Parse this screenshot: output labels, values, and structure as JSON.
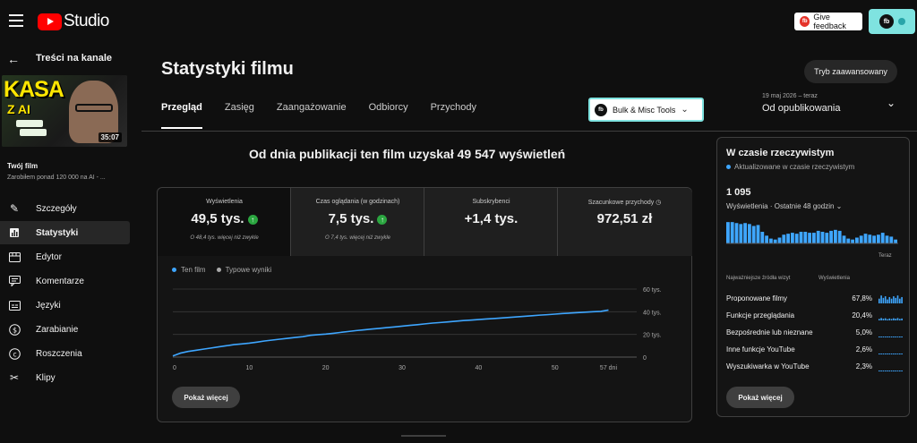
{
  "app": {
    "studio_label": "Studio",
    "feedback_label": "Give feedback",
    "feedback_icon": "fb",
    "account_icon": "fb"
  },
  "sidebar": {
    "back_title": "Treści na kanale",
    "thumbnail": {
      "text_main": "KASA",
      "text_sub": "Z AI",
      "duration": "35:07"
    },
    "film_label": "Twój film",
    "film_title": "Zarobiłem ponad 120 000 na AI - ...",
    "items": [
      {
        "label": "Szczegóły",
        "icon": "pencil-icon",
        "active": false
      },
      {
        "label": "Statystyki",
        "icon": "analytics-icon",
        "active": true
      },
      {
        "label": "Edytor",
        "icon": "editor-icon",
        "active": false
      },
      {
        "label": "Komentarze",
        "icon": "comments-icon",
        "active": false
      },
      {
        "label": "Języki",
        "icon": "subtitles-icon",
        "active": false
      },
      {
        "label": "Zarabianie",
        "icon": "dollar-icon",
        "active": false
      },
      {
        "label": "Roszczenia",
        "icon": "copyright-icon",
        "active": false
      },
      {
        "label": "Klipy",
        "icon": "scissors-icon",
        "active": false
      }
    ]
  },
  "main": {
    "title": "Statystyki filmu",
    "advanced_button": "Tryb zaawansowany",
    "tabs": [
      "Przegląd",
      "Zasięg",
      "Zaangażowanie",
      "Odbiorcy",
      "Przychody"
    ],
    "bulk_tools": {
      "label": "Bulk & Misc Tools",
      "icon": "fb"
    },
    "date_range": "19 maj 2026 – teraz",
    "date_label": "Od opublikowania",
    "headline": "Od dnia publikacji ten film uzyskał 49 547 wyświetleń",
    "metrics": [
      {
        "label": "Wyświetlenia",
        "value": "49,5 tys.",
        "up": "↑",
        "sub": "O 48,4 tys. więcej niż zwykle"
      },
      {
        "label": "Czas oglądania (w godzinach)",
        "value": "7,5 tys.",
        "up": "↑",
        "sub": "O 7,4 tys. więcej niż zwykle"
      },
      {
        "label": "Subskrybenci",
        "value": "+1,4 tys.",
        "up": "",
        "sub": ""
      },
      {
        "label": "Szacunkowe przychody",
        "value": "972,51 zł",
        "up": "",
        "sub": ""
      }
    ],
    "legend": {
      "this_film": "Ten film",
      "typical": "Typowe wyniki"
    },
    "show_more": "Pokaż więcej"
  },
  "chart_data": {
    "type": "line",
    "series": [
      {
        "name": "Ten film",
        "x": [
          0,
          1,
          2,
          3,
          4,
          5,
          6,
          7,
          8,
          9,
          10,
          11,
          12,
          13,
          14,
          15,
          16,
          17,
          18,
          19,
          20,
          21,
          22,
          23,
          24,
          25,
          26,
          27,
          28,
          29,
          30,
          31,
          32,
          33,
          34,
          35,
          36,
          37,
          38,
          39,
          40,
          41,
          42,
          43,
          44,
          45,
          46,
          47,
          48,
          49,
          50,
          51,
          52,
          53,
          54,
          55,
          56,
          57
        ],
        "values": [
          1,
          3.5,
          5,
          6,
          7,
          8,
          9,
          10,
          11,
          11.6,
          12.3,
          13.2,
          14.2,
          15,
          15.8,
          16.5,
          17.3,
          18,
          19.2,
          19.8,
          20.3,
          21,
          21.8,
          22.6,
          23.4,
          24,
          24.7,
          25.3,
          26,
          26.6,
          27.3,
          28,
          28.6,
          29.3,
          30,
          30.5,
          31,
          31.6,
          32.2,
          32.6,
          33.1,
          33.6,
          34,
          34.5,
          35,
          35.5,
          36,
          36.5,
          37,
          37.4,
          37.9,
          38.4,
          38.8,
          39.2,
          39.6,
          40,
          40.3,
          41.5
        ]
      }
    ],
    "x_ticks": [
      "0",
      "10",
      "20",
      "30",
      "40",
      "50",
      "57 dni"
    ],
    "x_tick_values": [
      0,
      10,
      20,
      30,
      40,
      50,
      57
    ],
    "y_ticks": [
      "0",
      "20 tys.",
      "40 tys.",
      "60 tys."
    ],
    "y_tick_values": [
      0,
      20,
      40,
      60
    ],
    "xlim": [
      0,
      58
    ],
    "ylim": [
      0,
      60
    ],
    "grid": true,
    "legend": "top-left",
    "colors": {
      "line": "#3ea6ff",
      "typical": "#aaaaaa"
    }
  },
  "realtime": {
    "title": "W czasie rzeczywistym",
    "subtitle": "Aktualizowane w czasie rzeczywistym",
    "count": "1 095",
    "metric": "Wyświetlenia · Ostatnie 48 godzin",
    "now_label": "Teraz",
    "bars": [
      22,
      22,
      21,
      20,
      21,
      20,
      18,
      19,
      12,
      8,
      5,
      4,
      6,
      9,
      10,
      11,
      10,
      12,
      12,
      11,
      11,
      13,
      12,
      11,
      13,
      14,
      13,
      8,
      5,
      4,
      6,
      8,
      10,
      9,
      8,
      9,
      11,
      8,
      7,
      4
    ],
    "sources_header": "Najważniejsze źródła wizyt",
    "sources_metric": "Wyświetlenia",
    "sources": [
      {
        "name": "Proponowane filmy",
        "pct": "67,8%",
        "level": 0.678
      },
      {
        "name": "Funkcje przeglądania",
        "pct": "20,4%",
        "level": 0.204
      },
      {
        "name": "Bezpośrednie lub nieznane",
        "pct": "5,0%",
        "level": 0.05
      },
      {
        "name": "Inne funkcje YouTube",
        "pct": "2,6%",
        "level": 0.026
      },
      {
        "name": "Wyszukiwarka w YouTube",
        "pct": "2,3%",
        "level": 0.023
      }
    ],
    "show_more": "Pokaż więcej"
  }
}
